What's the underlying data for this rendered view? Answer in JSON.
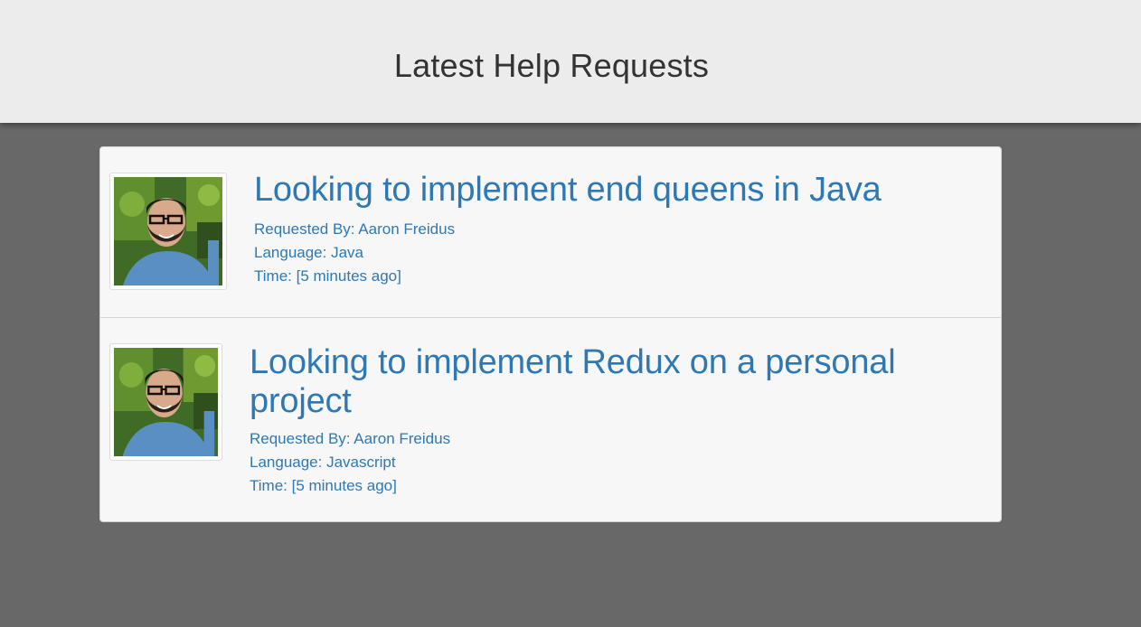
{
  "header": {
    "title": "Latest Help Requests"
  },
  "requests": [
    {
      "title": "Looking to implement end queens in Java",
      "requested_by": "Requested By: Aaron Freidus",
      "language": "Language: Java",
      "time": "Time: [5 minutes ago]",
      "avatar": "person-photo"
    },
    {
      "title": "Looking to implement Redux on a personal project",
      "requested_by": "Requested By: Aaron Freidus",
      "language": "Language: Javascript",
      "time": "Time: [5 minutes ago]",
      "avatar": "person-photo"
    }
  ],
  "colors": {
    "page_background": "#686868",
    "header_background": "#ececec",
    "card_background": "#f7f7f7",
    "link_blue": "#2e78b4",
    "header_text": "#333333"
  }
}
